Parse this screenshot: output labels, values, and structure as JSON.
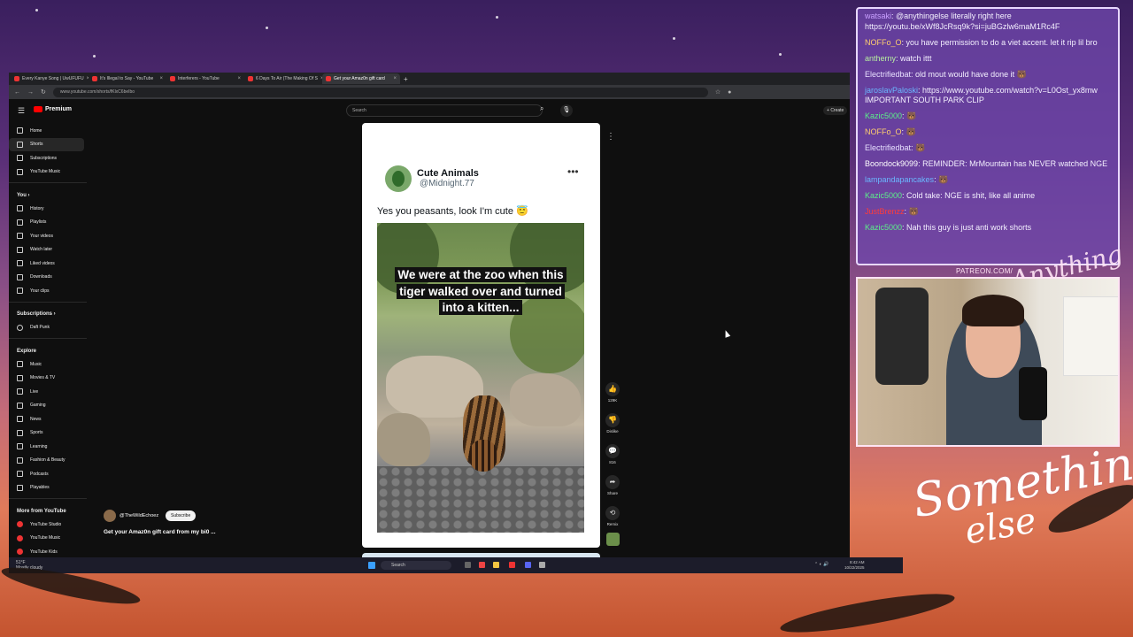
{
  "browser": {
    "tabs": [
      {
        "label": "Every Kanye Song | UwUFUFU",
        "active": false
      },
      {
        "label": "It's Illegal to Say - YouTube",
        "active": false
      },
      {
        "label": "Interferers - YouTube",
        "active": false
      },
      {
        "label": "6 Days To Air (The Making Of S",
        "active": false
      },
      {
        "label": "Get your Amaz0n gift card",
        "active": true
      }
    ],
    "url": "www.youtube.com/shorts/fKlxC6beIbo"
  },
  "youtube": {
    "logo_text": "Premium",
    "search_placeholder": "Search",
    "create_label": "Create",
    "sidebar": {
      "main": [
        "Home",
        "Shorts",
        "Subscriptions",
        "YouTube Music"
      ],
      "you_heading": "You",
      "you_items": [
        "History",
        "Playlists",
        "Your videos",
        "Watch later",
        "Liked videos",
        "Downloads",
        "Your clips"
      ],
      "subscriptions_heading": "Subscriptions",
      "subscriptions_items": [
        "Daft Punk"
      ],
      "explore_heading": "Explore",
      "explore_items": [
        "Music",
        "Movies & TV",
        "Live",
        "Gaming",
        "News",
        "Sports",
        "Learning",
        "Fashion & Beauty",
        "Podcasts",
        "Playables"
      ],
      "more_heading": "More from YouTube",
      "more_items": [
        "YouTube Studio",
        "YouTube Music",
        "YouTube Kids"
      ]
    },
    "short": {
      "post_channel_name": "Cute Animals",
      "post_channel_handle": "@Midnight.77",
      "post_caption": "Yes you peasants, look I'm cute 😇",
      "video_overlay_text": "We were at the zoo when this tiger walked over and turned into a kitten...",
      "creator_handle": "@TheWildEchoez",
      "subscribe_label": "Subscribe",
      "title": "Get your Amaz0n gift card from my bi0 ...",
      "actions": {
        "like_count": "129K",
        "dislike_label": "Dislike",
        "comment_count": "816",
        "share_label": "Share",
        "remix_label": "Remix"
      }
    }
  },
  "taskbar": {
    "weather_temp": "51°F",
    "weather_desc": "Mostly cloudy",
    "search_label": "Search",
    "time": "8:42 AM",
    "date": "10/22/2025"
  },
  "chat": {
    "messages": [
      {
        "user": "watsaki",
        "user_color": "#c9a0ff",
        "text": "@anythingelse literally right here https://youtu.be/xWf8JcRsq9k?si=juBGzlw6maM1Rc4F"
      },
      {
        "user": "NOFFo_O",
        "user_color": "#ffcf6e",
        "text": "you have permission to do a viet accent. let it rip lil bro"
      },
      {
        "user": "antherny",
        "user_color": "#b8f0a0",
        "text": "watch ittt"
      },
      {
        "user": "Electrifiedbat",
        "user_color": "#e8e0ff",
        "text": "old mout would have done it 🐻"
      },
      {
        "user": "jaroslavPaloski",
        "user_color": "#6ab8ff",
        "text": "https://www.youtube.com/watch?v=L0Ost_yx8mw IMPORTANT SOUTH PARK CLIP"
      },
      {
        "user": "Kazic5000",
        "user_color": "#5cf08a",
        "text": "🐻"
      },
      {
        "user": "NOFFo_O",
        "user_color": "#ffcf6e",
        "text": "🐻"
      },
      {
        "user": "Electrifiedbat",
        "user_color": "#e8e0ff",
        "text": "🐻"
      },
      {
        "user": "Boondock9099",
        "user_color": "#ffffff",
        "text": "REMINDER: MrMountain has NEVER watched NGE"
      },
      {
        "user": "lampandapancakes",
        "user_color": "#6ab8ff",
        "text": "🐻"
      },
      {
        "user": "Kazic5000",
        "user_color": "#5cf08a",
        "text": "Cold take: NGE is shit, like all anime"
      },
      {
        "user": "JustBrenzz",
        "user_color": "#ff3b3b",
        "text": "🐻"
      },
      {
        "user": "Kazic5000",
        "user_color": "#5cf08a",
        "text": "Nah this guy is just anti work shorts"
      }
    ]
  },
  "overlay": {
    "patreon": "PATREON.COM/",
    "brand_top": "Anything Else",
    "brand_main": "Something",
    "brand_sub": "else"
  }
}
